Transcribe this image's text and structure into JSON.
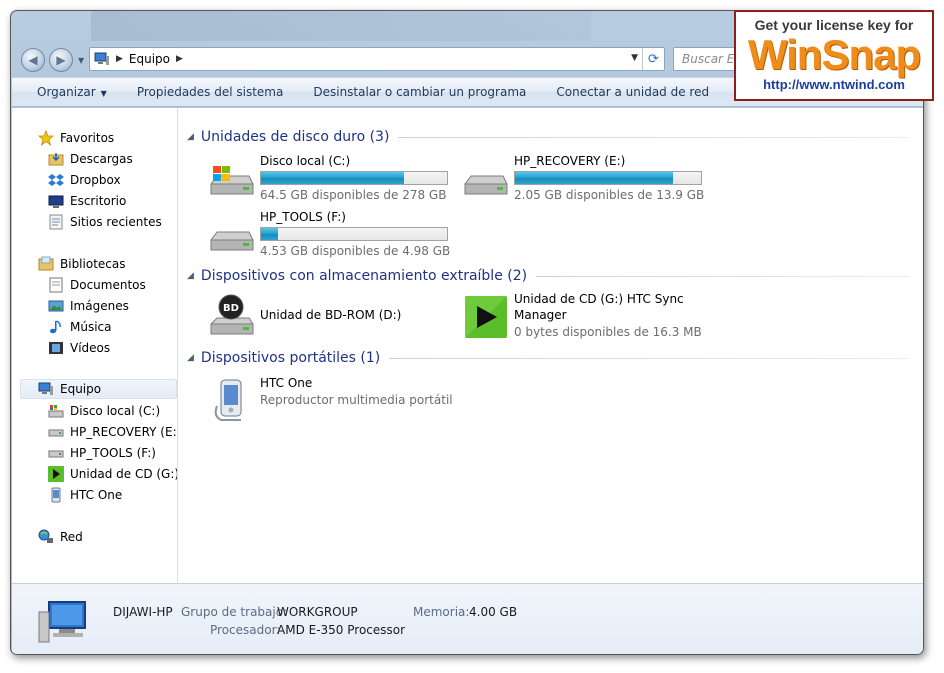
{
  "address": {
    "crumb": "Equipo",
    "search_placeholder": "Buscar Eq"
  },
  "toolbar": {
    "items": [
      "Organizar",
      "Propiedades del sistema",
      "Desinstalar o cambiar un programa",
      "Conectar a unidad de red"
    ],
    "more": "»"
  },
  "nav": {
    "favorites": "Favoritos",
    "fav_items": [
      "Descargas",
      "Dropbox",
      "Escritorio",
      "Sitios recientes"
    ],
    "libraries": "Bibliotecas",
    "lib_items": [
      "Documentos",
      "Imágenes",
      "Música",
      "Vídeos"
    ],
    "computer": "Equipo",
    "comp_items": [
      "Disco local (C:)",
      "HP_RECOVERY (E:)",
      "HP_TOOLS (F:)",
      "Unidad de CD (G:) H",
      "HTC One"
    ],
    "network": "Red"
  },
  "groups": {
    "hdd": "Unidades de disco duro (3)",
    "removable": "Dispositivos con almacenamiento extraíble (2)",
    "portable": "Dispositivos portátiles (1)"
  },
  "drives": [
    {
      "name": "Disco local (C:)",
      "free": "64.5 GB disponibles de 278 GB",
      "used_fraction": 0.77
    },
    {
      "name": "HP_RECOVERY (E:)",
      "free": "2.05 GB disponibles de 13.9 GB",
      "used_fraction": 0.85
    },
    {
      "name": "HP_TOOLS (F:)",
      "free": "4.53 GB disponibles de 4.98 GB",
      "used_fraction": 0.09
    }
  ],
  "removable": [
    {
      "name": "Unidad de BD-ROM (D:)"
    },
    {
      "name1": "Unidad de CD (G:) HTC Sync",
      "name2": "Manager",
      "free": "0 bytes disponibles de 16.3 MB"
    }
  ],
  "portable": {
    "name": "HTC One",
    "sub": "Reproductor multimedia portátil"
  },
  "details": {
    "pc_name": "DIJAWI-HP",
    "workgroup_label": "Grupo de trabajo:",
    "workgroup": "WORKGROUP",
    "memory_label": "Memoria:",
    "memory": "4.00 GB",
    "cpu_label": "Procesador:",
    "cpu": "AMD E-350 Processor"
  },
  "banner": {
    "line1": "Get your license key for",
    "line2": "WinSnap",
    "line3": "http://www.ntwind.com"
  },
  "colors": {
    "bar_fill": "#26a0cf",
    "group_heading": "#1e3287",
    "banner_orange": "#f08c1a"
  }
}
